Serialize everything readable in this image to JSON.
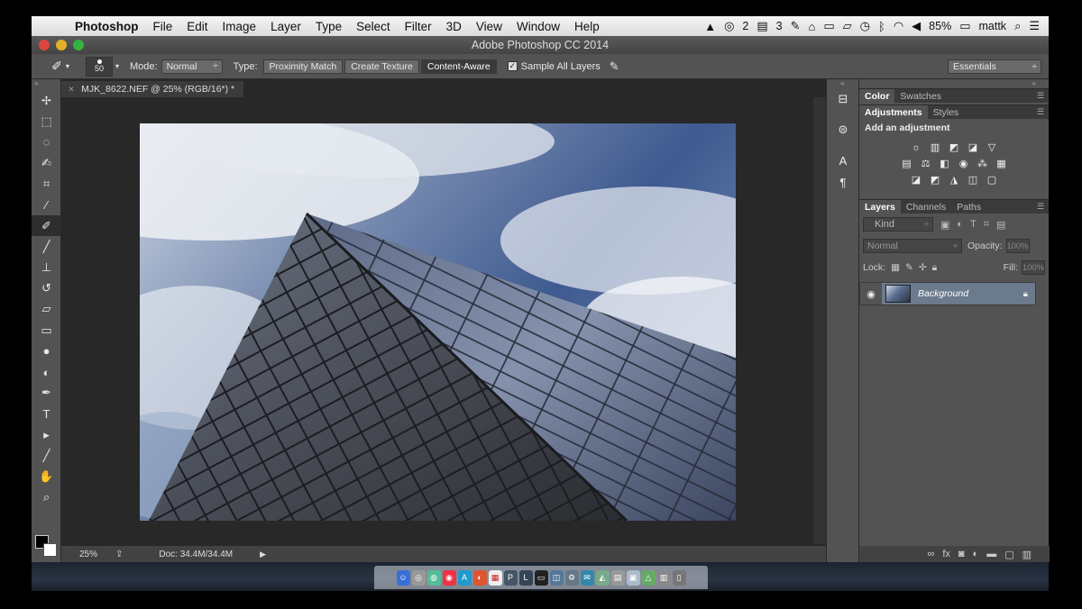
{
  "menubar": {
    "app": "Photoshop",
    "items": [
      "File",
      "Edit",
      "Image",
      "Layer",
      "Type",
      "Select",
      "Filter",
      "3D",
      "View",
      "Window",
      "Help"
    ],
    "status": {
      "badge1": "2",
      "badge2": "3",
      "battery": "85%",
      "user": "mattk"
    }
  },
  "window": {
    "title": "Adobe Photoshop CC 2014"
  },
  "options": {
    "brush_size": "50",
    "mode_label": "Mode:",
    "mode_value": "Normal",
    "type_label": "Type:",
    "type_options": [
      "Proximity Match",
      "Create Texture",
      "Content-Aware"
    ],
    "sample_all": "Sample All Layers",
    "workspace": "Essentials"
  },
  "document": {
    "tab_title": "MJK_8622.NEF @ 25% (RGB/16*) *",
    "zoom": "25%",
    "doc_size": "Doc: 34.4M/34.4M"
  },
  "panels": {
    "top_tabs": [
      "Color",
      "Swatches"
    ],
    "adj_tabs": [
      "Adjustments",
      "Styles"
    ],
    "adj_heading": "Add an adjustment",
    "layer_tabs": [
      "Layers",
      "Channels",
      "Paths"
    ],
    "kind": "Kind",
    "blend": "Normal",
    "opacity_label": "Opacity:",
    "opacity_value": "100%",
    "lock_label": "Lock:",
    "fill_label": "Fill:",
    "fill_value": "100%",
    "layer_name": "Background"
  },
  "colors": {
    "accent": "#6b7a8c",
    "panel": "#535353",
    "canvas_bg": "#282828"
  }
}
